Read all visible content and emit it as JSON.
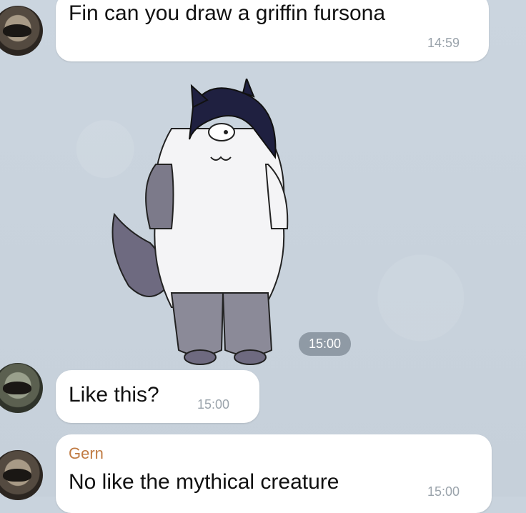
{
  "messages": [
    {
      "text": "Fin can you draw a griffin fursona",
      "time": "14:59"
    },
    {
      "time": "15:00"
    },
    {
      "text": "Like this?",
      "time": "15:00"
    },
    {
      "sender": "Gern",
      "text": "No like the mythical creature",
      "time": "15:00"
    }
  ],
  "colors": {
    "bubble": "#ffffff",
    "sender_name": "#c07b43",
    "chat_bg": "#c9d3dd"
  }
}
